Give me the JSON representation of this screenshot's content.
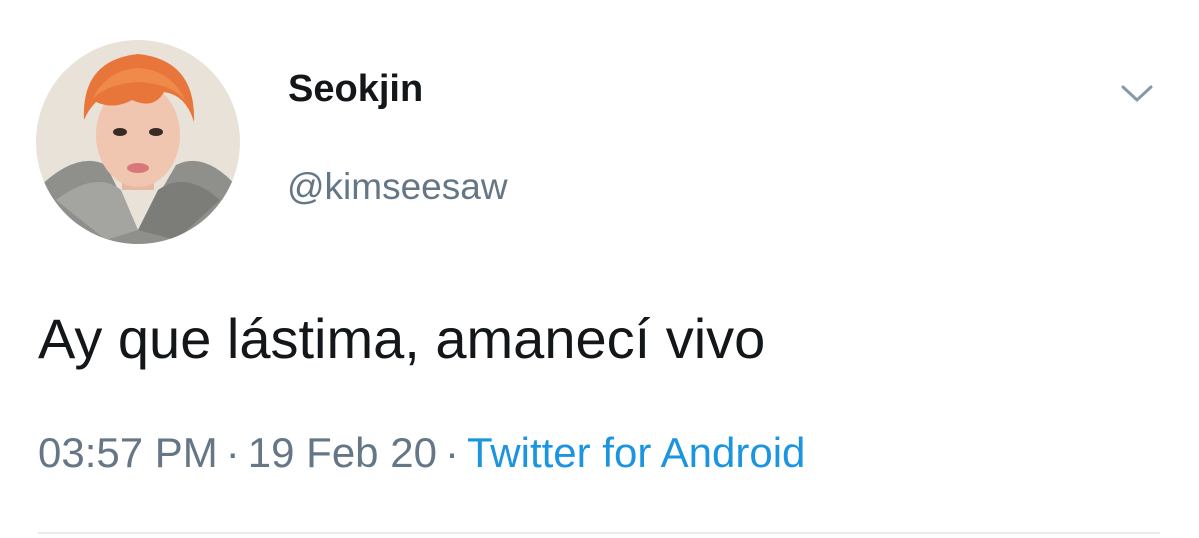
{
  "tweet": {
    "author": {
      "display_name": "Seokjin",
      "handle": "@kimseesaw",
      "avatar_icon": "profile-photo"
    },
    "menu_icon": "chevron-down-icon",
    "text": "Ay que lástima, amanecí vivo",
    "time": "03:57 PM",
    "date": "19 Feb 20",
    "separator": "·",
    "source": "Twitter for Android"
  },
  "colors": {
    "text_primary": "#14171a",
    "text_secondary": "#657786",
    "link": "#1b95e0",
    "divider": "#e6ecf0"
  }
}
